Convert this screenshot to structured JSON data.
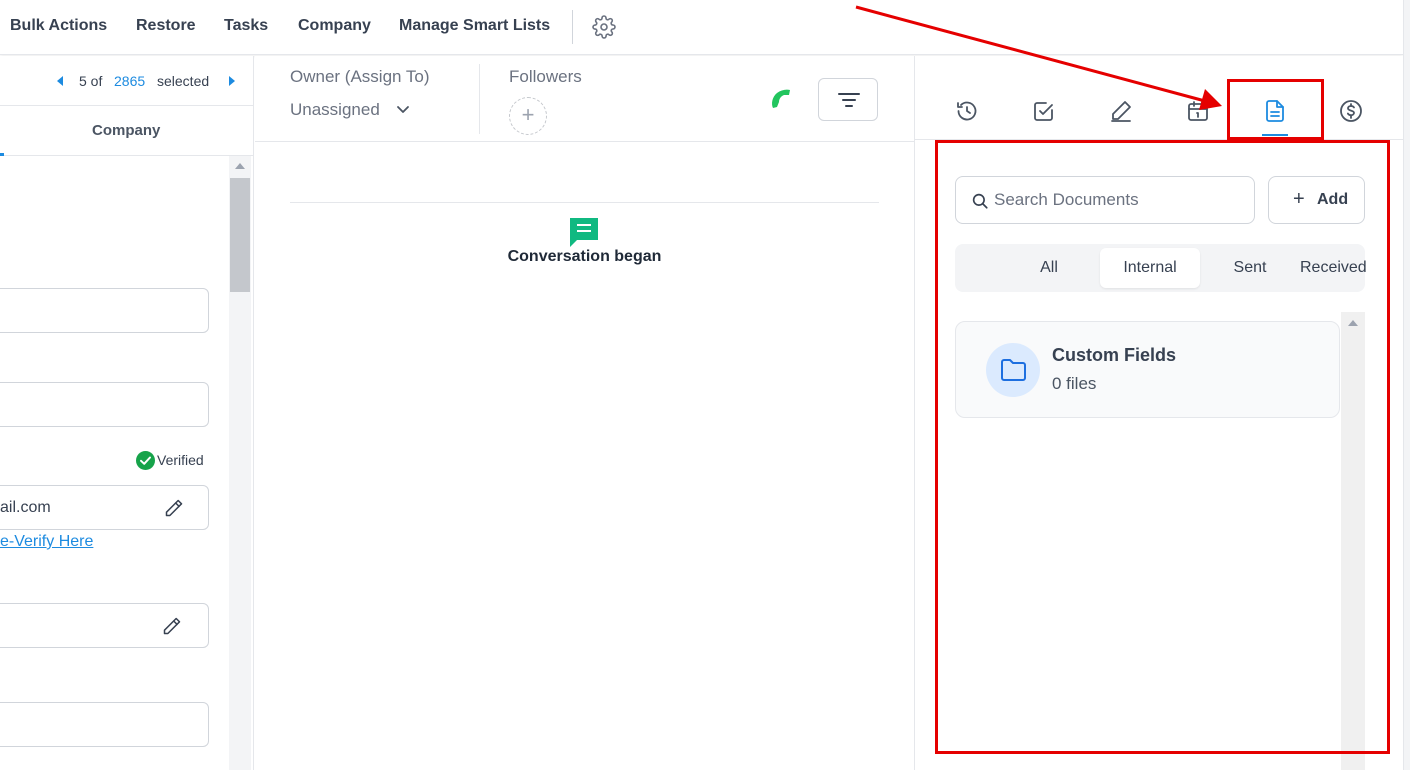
{
  "topnav": {
    "items": [
      "Bulk Actions",
      "Restore",
      "Tasks",
      "Company",
      "Manage Smart Lists"
    ]
  },
  "left": {
    "pager": {
      "position": "5 of",
      "total": "2865",
      "suffix": "selected"
    },
    "tab_company": "Company",
    "email_value": "ail.com",
    "verified_label": "Verified",
    "reverify_link": "e-Verify Here"
  },
  "middle": {
    "owner_label": "Owner (Assign To)",
    "owner_value": "Unassigned",
    "followers_label": "Followers",
    "conversation_text": "Conversation began"
  },
  "right": {
    "tab_icons": [
      "activity-icon",
      "task-icon",
      "notes-icon",
      "appointment-icon",
      "documents-icon",
      "payments-icon"
    ],
    "active_tab": "documents-icon",
    "search_placeholder": "Search Documents",
    "add_label": "Add",
    "filters": [
      "All",
      "Internal",
      "Sent",
      "Received"
    ],
    "active_filter": "Internal",
    "folder": {
      "name": "Custom Fields",
      "count": "0 files"
    }
  },
  "colors": {
    "accent": "#1d8be0",
    "annotation": "#e50000",
    "verified": "#16a34a",
    "phone": "#22c55e",
    "conversation": "#10b981"
  }
}
